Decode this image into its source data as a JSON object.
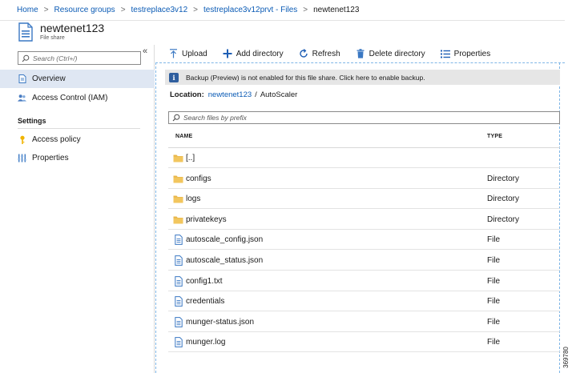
{
  "breadcrumb": {
    "items": [
      "Home",
      "Resource groups",
      "testreplace3v12",
      "testreplace3v12prvt - Files",
      "newtenet123"
    ]
  },
  "header": {
    "title": "newtenet123",
    "subtitle": "File share"
  },
  "sidebar": {
    "search_placeholder": "Search (Ctrl+/)",
    "collapse_glyph": "«",
    "items": [
      {
        "label": "Overview",
        "icon": "overview-icon",
        "active": true
      },
      {
        "label": "Access Control (IAM)",
        "icon": "users-icon",
        "active": false
      }
    ],
    "settings_heading": "Settings",
    "settings_items": [
      {
        "label": "Access policy",
        "icon": "key-icon"
      },
      {
        "label": "Properties",
        "icon": "properties-icon"
      }
    ]
  },
  "toolbar": {
    "upload": "Upload",
    "add_directory": "Add directory",
    "refresh": "Refresh",
    "delete_directory": "Delete directory",
    "properties": "Properties"
  },
  "info_bar": {
    "text": "Backup (Preview) is not enabled for this file share. Click here to enable backup."
  },
  "location": {
    "label": "Location:",
    "link": "newtenet123",
    "separator": "/",
    "current": "AutoScaler"
  },
  "file_search": {
    "placeholder": "Search files by prefix"
  },
  "table": {
    "columns": [
      "NAME",
      "TYPE"
    ],
    "rows": [
      {
        "name": "[..]",
        "type": "",
        "kind": "folder"
      },
      {
        "name": "configs",
        "type": "Directory",
        "kind": "folder"
      },
      {
        "name": "logs",
        "type": "Directory",
        "kind": "folder"
      },
      {
        "name": "privatekeys",
        "type": "Directory",
        "kind": "folder"
      },
      {
        "name": "autoscale_config.json",
        "type": "File",
        "kind": "file"
      },
      {
        "name": "autoscale_status.json",
        "type": "File",
        "kind": "file"
      },
      {
        "name": "config1.txt",
        "type": "File",
        "kind": "file"
      },
      {
        "name": "credentials",
        "type": "File",
        "kind": "file"
      },
      {
        "name": "munger-status.json",
        "type": "File",
        "kind": "file"
      },
      {
        "name": "munger.log",
        "type": "File",
        "kind": "file"
      }
    ]
  },
  "figure_id": "369780",
  "colors": {
    "link": "#0b5bb5",
    "active_nav": "#dfe7f3",
    "folder": "#e8b64a",
    "file": "#3a78c3",
    "info_icon": "#2f5e9e",
    "info_bar": "#e6e6e6"
  }
}
